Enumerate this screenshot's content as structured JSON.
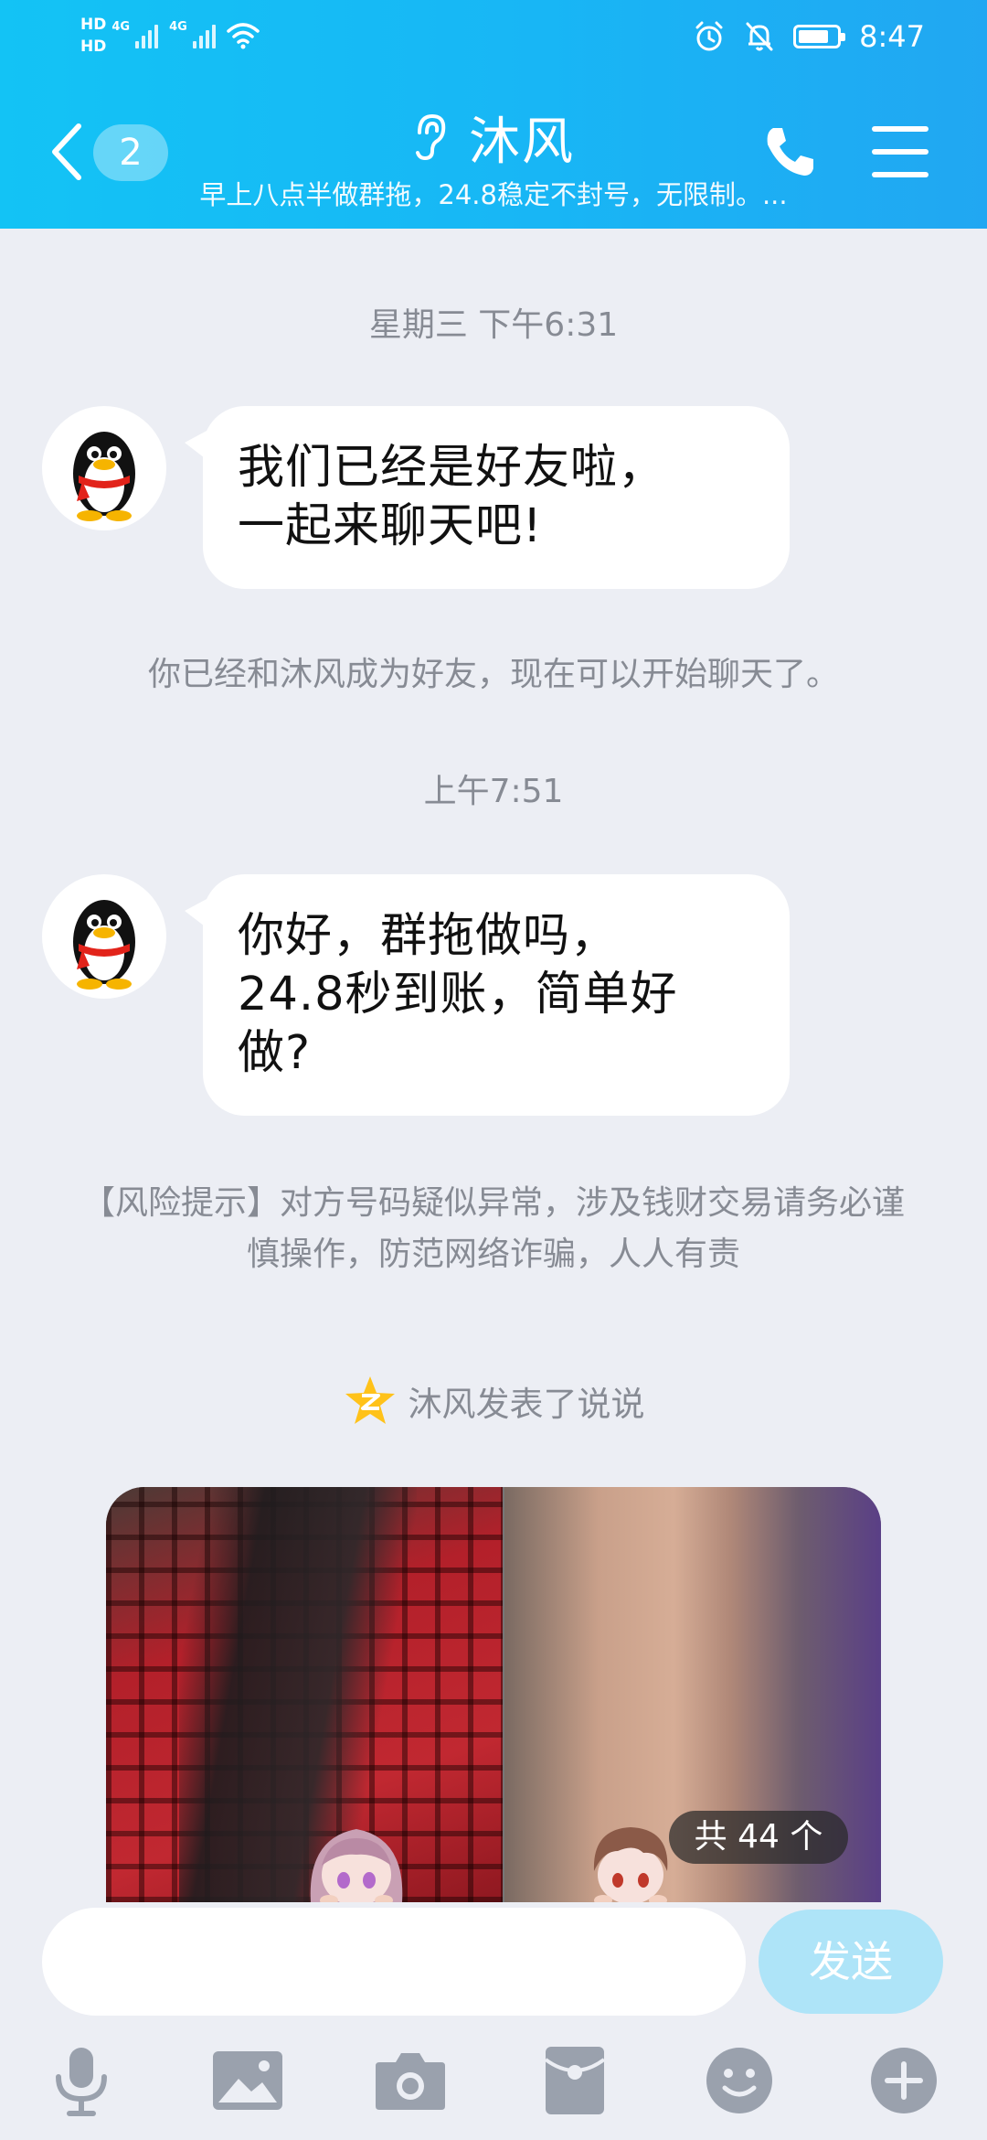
{
  "status_bar": {
    "hd1": "HD",
    "hd2": "HD",
    "net1": "4G",
    "net2": "4G",
    "time": "8:47"
  },
  "header": {
    "unread_count": "2",
    "title": "沐风",
    "subtitle": "早上八点半做群拖，24.8稳定不封号，无限制。..."
  },
  "messages": [
    {
      "timestamp": "星期三 下午6:31",
      "text_line1": "我们已经是好友啦，",
      "text_line2": "一起来聊天吧!"
    },
    {
      "system": "你已经和沐风成为好友，现在可以开始聊天了。"
    },
    {
      "timestamp": "上午7:51",
      "text_line1": "你好，群拖做吗，",
      "text_line2": "24.8秒到账，简单好",
      "text_line3": "做?"
    },
    {
      "system": "【风险提示】对方号码疑似异常，涉及钱财交易请务必谨慎操作，防范网络诈骗，人人有责"
    }
  ],
  "qzone": {
    "note": "沐风发表了说说",
    "photo_count": "共 44 个"
  },
  "input": {
    "placeholder": "",
    "send_label": "发送"
  },
  "toolbar": [
    "mic-icon",
    "image-icon",
    "camera-icon",
    "red-packet-icon",
    "emoji-icon",
    "plus-icon"
  ],
  "colors": {
    "header_start": "#13c3f5",
    "header_end": "#21a7f2",
    "background": "#eceef4",
    "send_disabled": "#aee4f8",
    "toolbar_icon": "#9aa1ad"
  }
}
